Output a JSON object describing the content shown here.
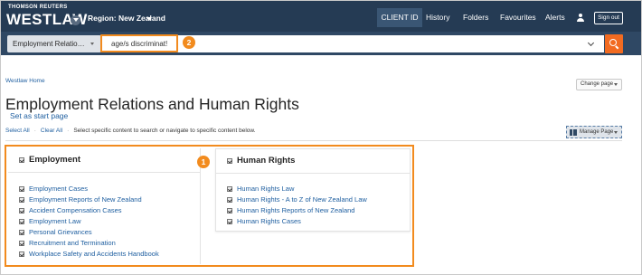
{
  "header": {
    "brand_top": "THOMSON REUTERS",
    "brand_name": "WESTLAW",
    "region": "Region: New Zealand",
    "nav": [
      "CLIENT ID",
      "History",
      "Folders",
      "Favourites",
      "Alerts"
    ],
    "sign_out": "Sign out"
  },
  "search": {
    "content_select": "Employment Relatio…",
    "query": "age/s discriminat!",
    "callout_number": "2"
  },
  "page": {
    "breadcrumb": "Westlaw Home",
    "change_page": "Change page",
    "title": "Employment Relations and Human Rights",
    "set_start": "Set as start page",
    "select_all": "Select All",
    "clear_all": "Clear All",
    "instruction": "Select specific content to search or navigate to specific content below.",
    "manage_page": "Manage Page",
    "callout_number": "1"
  },
  "panels": {
    "employment": {
      "title": "Employment",
      "items": [
        "Employment Cases",
        "Employment Reports of New Zealand",
        "Accident Compensation Cases",
        "Employment Law",
        "Personal Grievances",
        "Recruitment and Termination",
        "Workplace Safety and Accidents Handbook"
      ]
    },
    "human_rights": {
      "title": "Human Rights",
      "items": [
        "Human Rights Law",
        "Human Rights - A to Z of New Zealand Law",
        "Human Rights Reports of New Zealand",
        "Human Rights Cases"
      ]
    }
  },
  "colors": {
    "header_bg": "#253b54",
    "searchbar_bg": "#2f4864",
    "accent_orange": "#f26b21",
    "callout_orange": "#f28b1e",
    "link_blue": "#1f5fa0"
  }
}
